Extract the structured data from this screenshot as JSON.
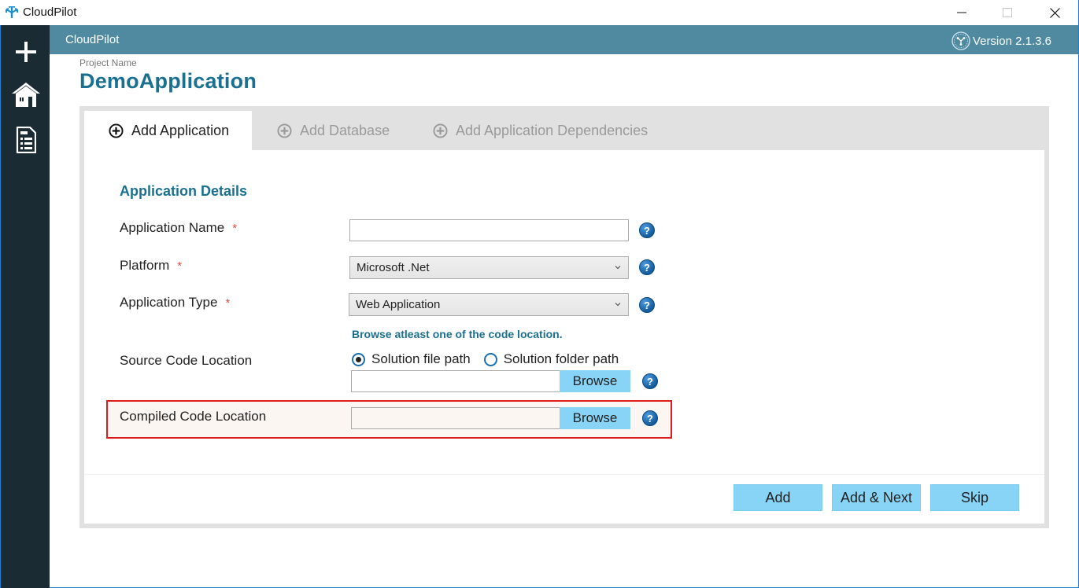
{
  "window": {
    "title": "CloudPilot",
    "controls": {
      "minimize": "minimize",
      "maximize": "maximize",
      "close": "close"
    }
  },
  "sidebar": {
    "items": [
      {
        "icon": "plus-icon",
        "label": "New"
      },
      {
        "icon": "home-icon",
        "label": "Home"
      },
      {
        "icon": "report-icon",
        "label": "Reports"
      }
    ]
  },
  "header": {
    "brand": "CloudPilot",
    "version": "Version 2.1.3.6"
  },
  "project": {
    "label": "Project Name",
    "name": "DemoApplication"
  },
  "tabs": [
    {
      "label": "Add Application",
      "active": true
    },
    {
      "label": "Add Database",
      "active": false
    },
    {
      "label": "Add Application Dependencies",
      "active": false
    }
  ],
  "form": {
    "section_title": "Application Details",
    "required_mark": "*",
    "help_glyph": "?",
    "fields": {
      "app_name": {
        "label": "Application Name",
        "value": "",
        "placeholder": ""
      },
      "platform": {
        "label": "Platform",
        "value": "Microsoft .Net"
      },
      "app_type": {
        "label": "Application Type",
        "value": "Web Application"
      },
      "hint": "Browse atleast one of the code location.",
      "source_code": {
        "label": "Source Code Location",
        "options": [
          {
            "label": "Solution file path",
            "selected": true
          },
          {
            "label": "Solution folder path",
            "selected": false
          }
        ],
        "value": "",
        "browse_label": "Browse"
      },
      "compiled_code": {
        "label": "Compiled Code Location",
        "value": "",
        "browse_label": "Browse"
      }
    }
  },
  "actions": {
    "add": "Add",
    "add_next": "Add & Next",
    "skip": "Skip"
  },
  "colors": {
    "header": "#4f8aa1",
    "sidebar": "#1a2b33",
    "accent_text": "#1a7090",
    "button": "#87d4f7",
    "highlight_border": "#e01b1b",
    "required": "#e04b4b"
  }
}
